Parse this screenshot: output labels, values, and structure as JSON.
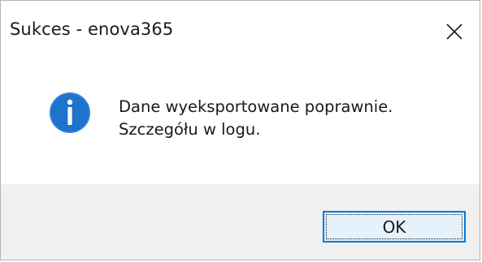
{
  "window": {
    "title": "Sukces - enova365"
  },
  "titlebar": {
    "close_icon": "close-icon"
  },
  "message": {
    "icon": "info-icon",
    "line1": "Dane wyeksportowane poprawnie.",
    "line2": "Szczegółu w logu."
  },
  "footer": {
    "ok_label": "OK"
  },
  "colors": {
    "accent": "#0078d7",
    "info_icon": "#1e73cc",
    "footer_bg": "#f0f0f0",
    "button_bg": "#e5f1fb"
  }
}
